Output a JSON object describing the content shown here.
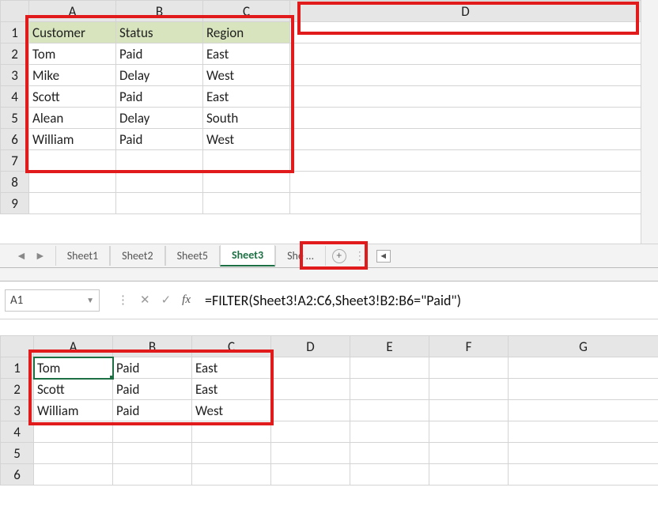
{
  "top_grid": {
    "cols": [
      "A",
      "B",
      "C",
      "D"
    ],
    "rows": [
      "1",
      "2",
      "3",
      "4",
      "5",
      "6",
      "7",
      "8",
      "9"
    ],
    "headers": {
      "a": "Customer",
      "b": "Status",
      "c": "Region"
    },
    "data": [
      {
        "a": "Tom",
        "b": "Paid",
        "c": "East"
      },
      {
        "a": "Mike",
        "b": "Delay",
        "c": "West"
      },
      {
        "a": "Scott",
        "b": "Paid",
        "c": "East"
      },
      {
        "a": "Alean",
        "b": "Delay",
        "c": "South"
      },
      {
        "a": "William",
        "b": "Paid",
        "c": "West"
      }
    ]
  },
  "tabs": {
    "t0": "Sheet1",
    "t1": "Sheet2",
    "t2": "Sheet5",
    "t3": "Sheet3",
    "t4": "She …"
  },
  "namebox": "A1",
  "formula": "=FILTER(Sheet3!A2:C6,Sheet3!B2:B6=\"Paid\")",
  "bottom_grid": {
    "cols": [
      "A",
      "B",
      "C",
      "D",
      "E",
      "F",
      "G"
    ],
    "rows": [
      "1",
      "2",
      "3",
      "4",
      "5",
      "6"
    ],
    "data": [
      {
        "a": "Tom",
        "b": "Paid",
        "c": "East"
      },
      {
        "a": "Scott",
        "b": "Paid",
        "c": "East"
      },
      {
        "a": "William",
        "b": "Paid",
        "c": "West"
      }
    ]
  },
  "chart_data": {
    "type": "table",
    "source_table": {
      "columns": [
        "Customer",
        "Status",
        "Region"
      ],
      "rows": [
        [
          "Tom",
          "Paid",
          "East"
        ],
        [
          "Mike",
          "Delay",
          "West"
        ],
        [
          "Scott",
          "Paid",
          "East"
        ],
        [
          "Alean",
          "Delay",
          "South"
        ],
        [
          "William",
          "Paid",
          "West"
        ]
      ]
    },
    "filtered_result": {
      "formula": "=FILTER(Sheet3!A2:C6,Sheet3!B2:B6=\"Paid\")",
      "rows": [
        [
          "Tom",
          "Paid",
          "East"
        ],
        [
          "Scott",
          "Paid",
          "East"
        ],
        [
          "William",
          "Paid",
          "West"
        ]
      ]
    }
  }
}
